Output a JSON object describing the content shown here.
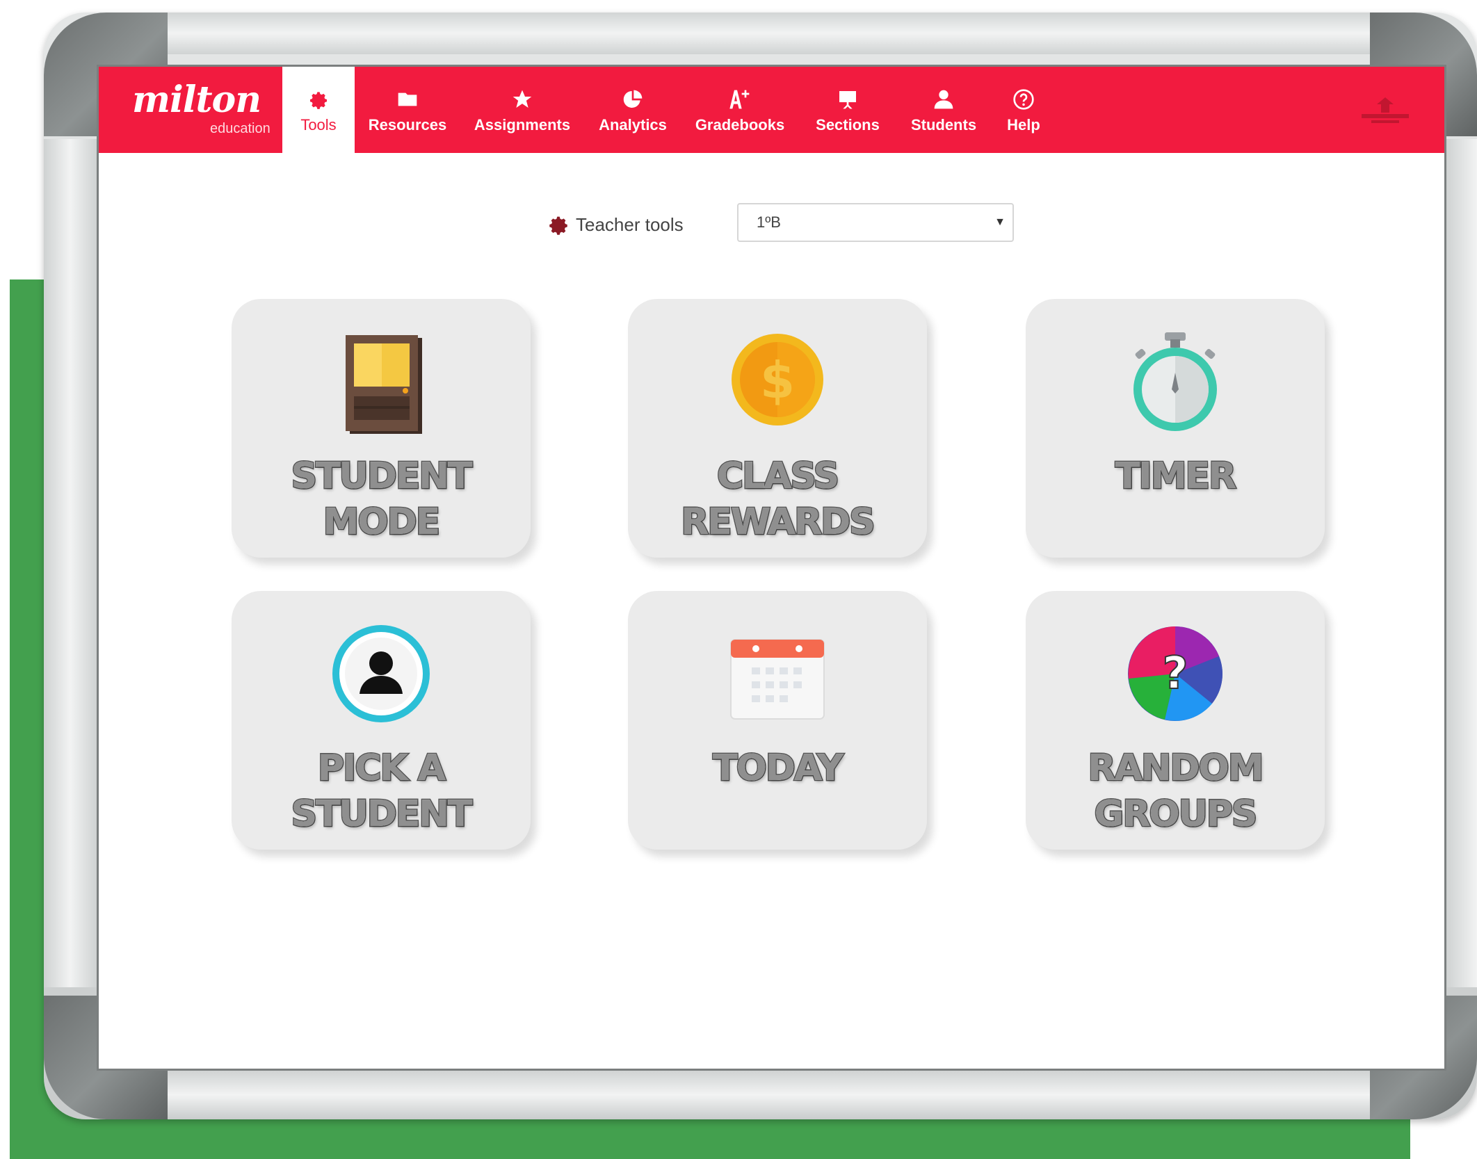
{
  "brand": {
    "name": "milton",
    "tagline": "education"
  },
  "colors": {
    "nav_bg": "#f21b3f",
    "card_bg": "#ebebeb",
    "background_green": "#43a04e"
  },
  "nav": {
    "items": [
      {
        "label": "Tools",
        "icon": "gear-icon",
        "active": true
      },
      {
        "label": "Resources",
        "icon": "folder-icon"
      },
      {
        "label": "Assignments",
        "icon": "star-icon"
      },
      {
        "label": "Analytics",
        "icon": "pie-chart-icon"
      },
      {
        "label": "Gradebooks",
        "icon": "grade-icon"
      },
      {
        "label": "Sections",
        "icon": "presentation-board-icon"
      },
      {
        "label": "Students",
        "icon": "user-icon"
      },
      {
        "label": "Help",
        "icon": "help-icon"
      }
    ]
  },
  "toolbar": {
    "label": "Teacher tools",
    "class_select": {
      "value": "1ºB"
    }
  },
  "tools": [
    {
      "line1": "STUDENT",
      "line2": "MODE",
      "icon": "door-icon"
    },
    {
      "line1": "CLASS",
      "line2": "REWARDS",
      "icon": "coin-icon"
    },
    {
      "line1": "TIMER",
      "line2": "",
      "icon": "stopwatch-icon"
    },
    {
      "line1": "PICK A",
      "line2": "STUDENT",
      "icon": "student-avatar-icon"
    },
    {
      "line1": "TODAY",
      "line2": "",
      "icon": "calendar-icon"
    },
    {
      "line1": "RANDOM",
      "line2": "GROUPS",
      "icon": "random-wheel-icon"
    }
  ]
}
